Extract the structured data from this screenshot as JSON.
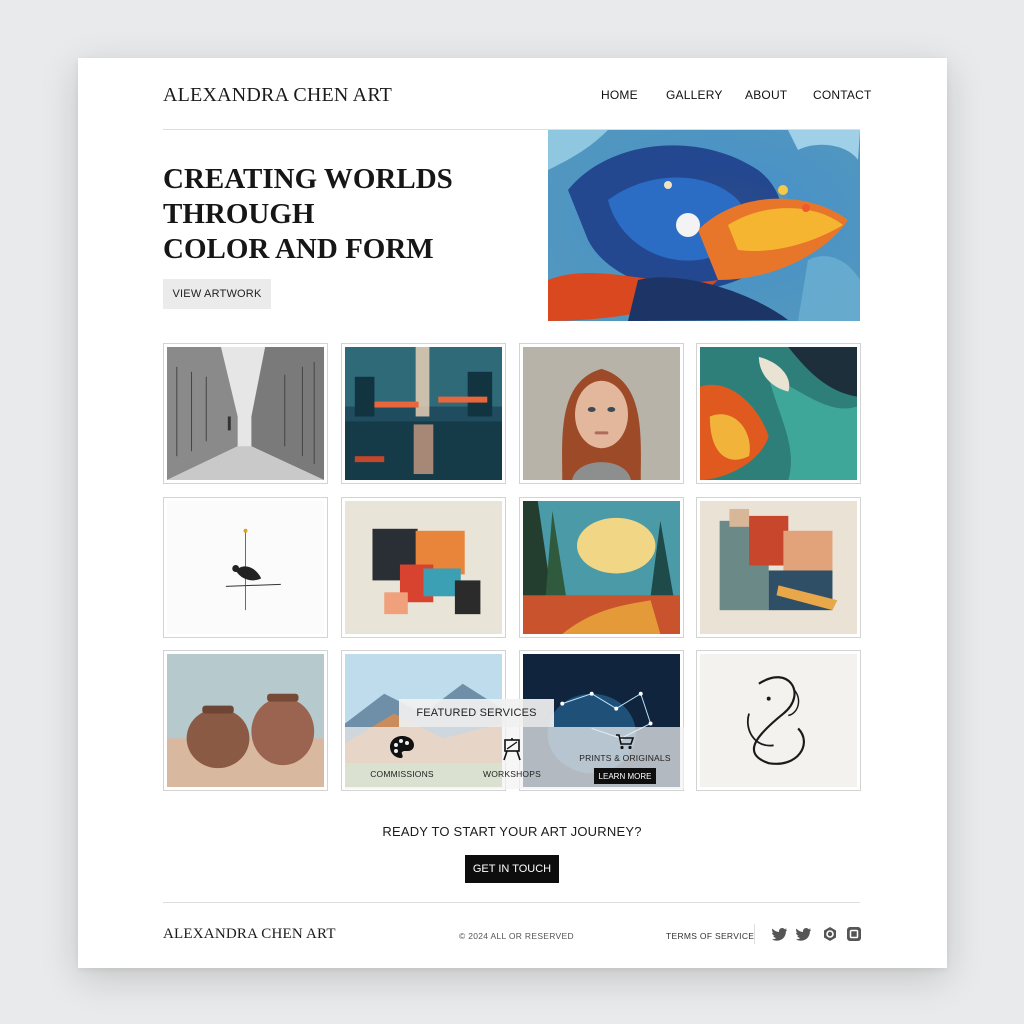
{
  "header": {
    "logo": "ALEXANDRA CHEN ART",
    "nav": [
      "HOME",
      "GALLERY",
      "ABOUT",
      "CONTACT"
    ]
  },
  "hero": {
    "title_lines": [
      "CREATING WORLDS",
      "THROUGH",
      "COLOR AND FORM"
    ],
    "button": "VIEW ARTWORK"
  },
  "services": {
    "heading": "FEATURED SERVICES",
    "items": [
      {
        "label": "COMMISSIONS",
        "icon": "palette-icon"
      },
      {
        "label": "WORKSHOPS",
        "icon": "easel-icon"
      },
      {
        "label": "PRINTS & ORIGINALS",
        "icon": "cart-icon"
      }
    ],
    "learn_more": "LEARN MORE"
  },
  "cta": {
    "text": "READY TO START YOUR ART JOURNEY?",
    "button": "GET IN TOUCH"
  },
  "footer": {
    "logo": "ALEXANDRA CHEN ART",
    "copyright": "© 2024 ALL OR RESERVED",
    "terms": "TERMS OF SERVICE",
    "social": [
      "twitter-icon",
      "twitter-icon",
      "circle-logo-icon",
      "square-logo-icon"
    ]
  },
  "colors": {
    "accent_dark": "#0d0d0d",
    "light_button": "#ebebeb",
    "page_bg": "#ffffff",
    "backdrop": "#e9eaeb"
  }
}
